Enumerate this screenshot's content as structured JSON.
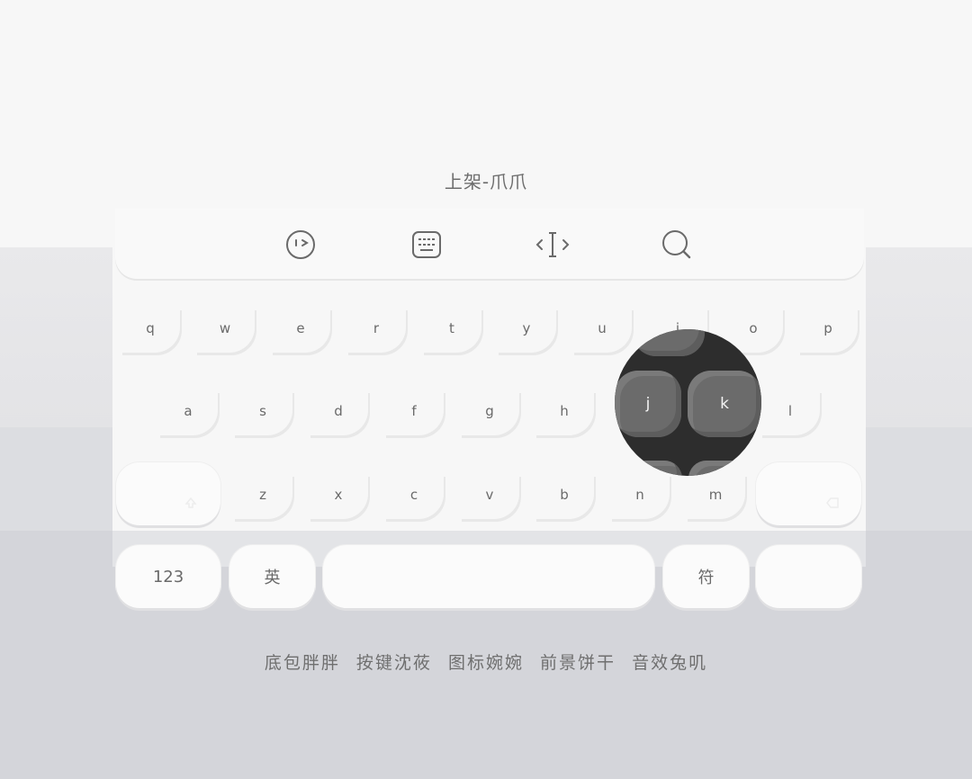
{
  "title": "上架-爪爪",
  "toolbar": {
    "icons": [
      "emoji-face-icon",
      "keyboard-icon",
      "cursor-move-icon",
      "search-icon"
    ]
  },
  "rows": {
    "row1": [
      "q",
      "w",
      "e",
      "r",
      "t",
      "y",
      "u",
      "i",
      "o",
      "p"
    ],
    "row2": [
      "a",
      "s",
      "d",
      "f",
      "g",
      "h",
      "j",
      "k",
      "l"
    ],
    "row3": [
      "z",
      "x",
      "c",
      "v",
      "b",
      "n",
      "m"
    ]
  },
  "bottom_row": {
    "numbers_label": "123",
    "lang_label": "英",
    "space_label": "",
    "symbols_label": "符",
    "enter_label": ""
  },
  "magnifier": {
    "keys": [
      "j",
      "k"
    ]
  },
  "footer": {
    "credits": [
      "底包胖胖",
      "按键沈莜",
      "图标婉婉",
      "前景饼干",
      "音效兔叽"
    ]
  },
  "colors": {
    "background": "#f7f7f7",
    "key_text": "#6a6a6a",
    "magnifier_bg": "#2d2d2d",
    "magnifier_key": "#6b6b6b"
  }
}
